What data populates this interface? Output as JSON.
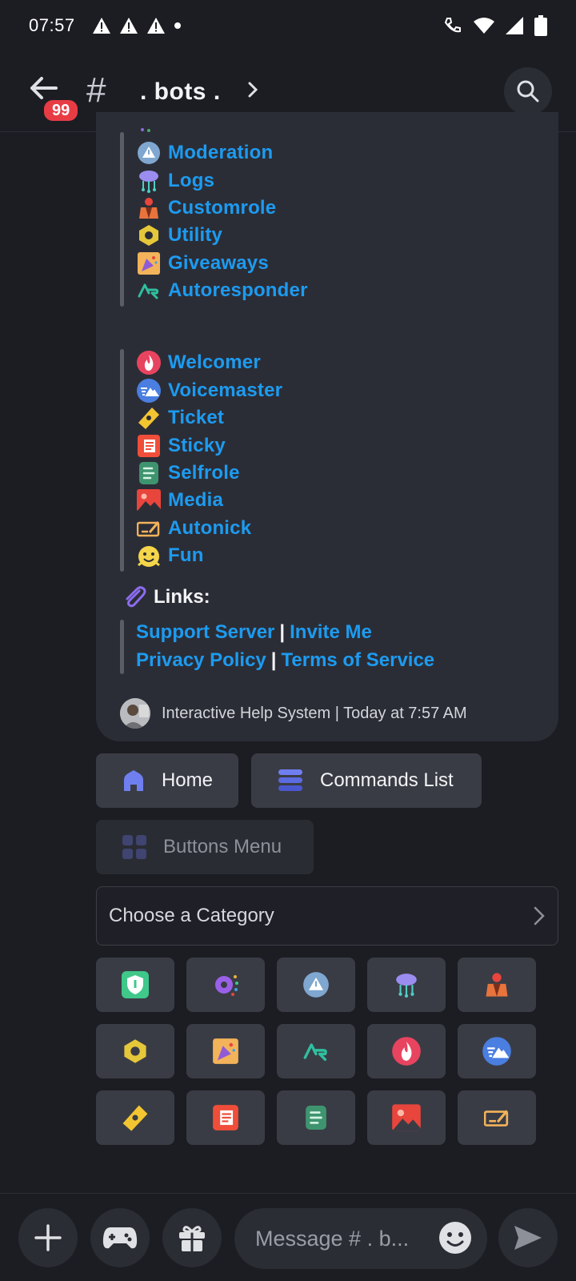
{
  "status_bar": {
    "time": "07:57"
  },
  "header": {
    "badge": "99",
    "hash": "#",
    "channel": ". bots ."
  },
  "embed": {
    "commands_top": [
      {
        "label": "Moderation",
        "icon": "warning-circle-icon"
      },
      {
        "label": "Logs",
        "icon": "cloud-network-icon"
      },
      {
        "label": "Customrole",
        "icon": "person-crown-icon"
      },
      {
        "label": "Utility",
        "icon": "hex-bolt-icon"
      },
      {
        "label": "Giveaways",
        "icon": "party-popper-icon"
      },
      {
        "label": "Autoresponder",
        "icon": "ar-logo-icon"
      }
    ],
    "commands_bottom": [
      {
        "label": "Welcomer",
        "icon": "flame-icon"
      },
      {
        "label": "Voicemaster",
        "icon": "wave-mountain-icon"
      },
      {
        "label": "Ticket",
        "icon": "ticket-icon"
      },
      {
        "label": "Sticky",
        "icon": "sticky-note-icon"
      },
      {
        "label": "Selfrole",
        "icon": "list-doc-icon"
      },
      {
        "label": "Media",
        "icon": "image-icon"
      },
      {
        "label": "Autonick",
        "icon": "name-tag-pen-icon"
      },
      {
        "label": "Fun",
        "icon": "happy-face-icon"
      }
    ],
    "links_heading": "Links:",
    "links_row1": {
      "a": "Support Server",
      "sep": "|",
      "b": "Invite Me"
    },
    "links_row2": {
      "a": "Privacy Policy",
      "sep": "|",
      "b": "Terms of Service"
    },
    "footer": "Interactive Help System | Today at 7:57 AM"
  },
  "buttons": {
    "home": "Home",
    "commands_list": "Commands List",
    "buttons_menu": "Buttons Menu"
  },
  "select": {
    "placeholder": "Choose a Category"
  },
  "category_icons": [
    "shield-icon",
    "gear-icon",
    "warning-circle-icon",
    "cloud-network-icon",
    "person-crown-icon",
    "hex-bolt-icon",
    "party-popper-icon",
    "ar-logo-icon",
    "flame-icon",
    "wave-mountain-icon",
    "ticket-icon",
    "sticky-note-icon",
    "list-doc-icon",
    "image-icon",
    "name-tag-pen-icon"
  ],
  "composer": {
    "placeholder": "Message # . b..."
  },
  "colors": {
    "link": "#1d9bf0",
    "badge": "#e83c45",
    "background": "#1c1d23",
    "embed": "#2b2d36"
  }
}
